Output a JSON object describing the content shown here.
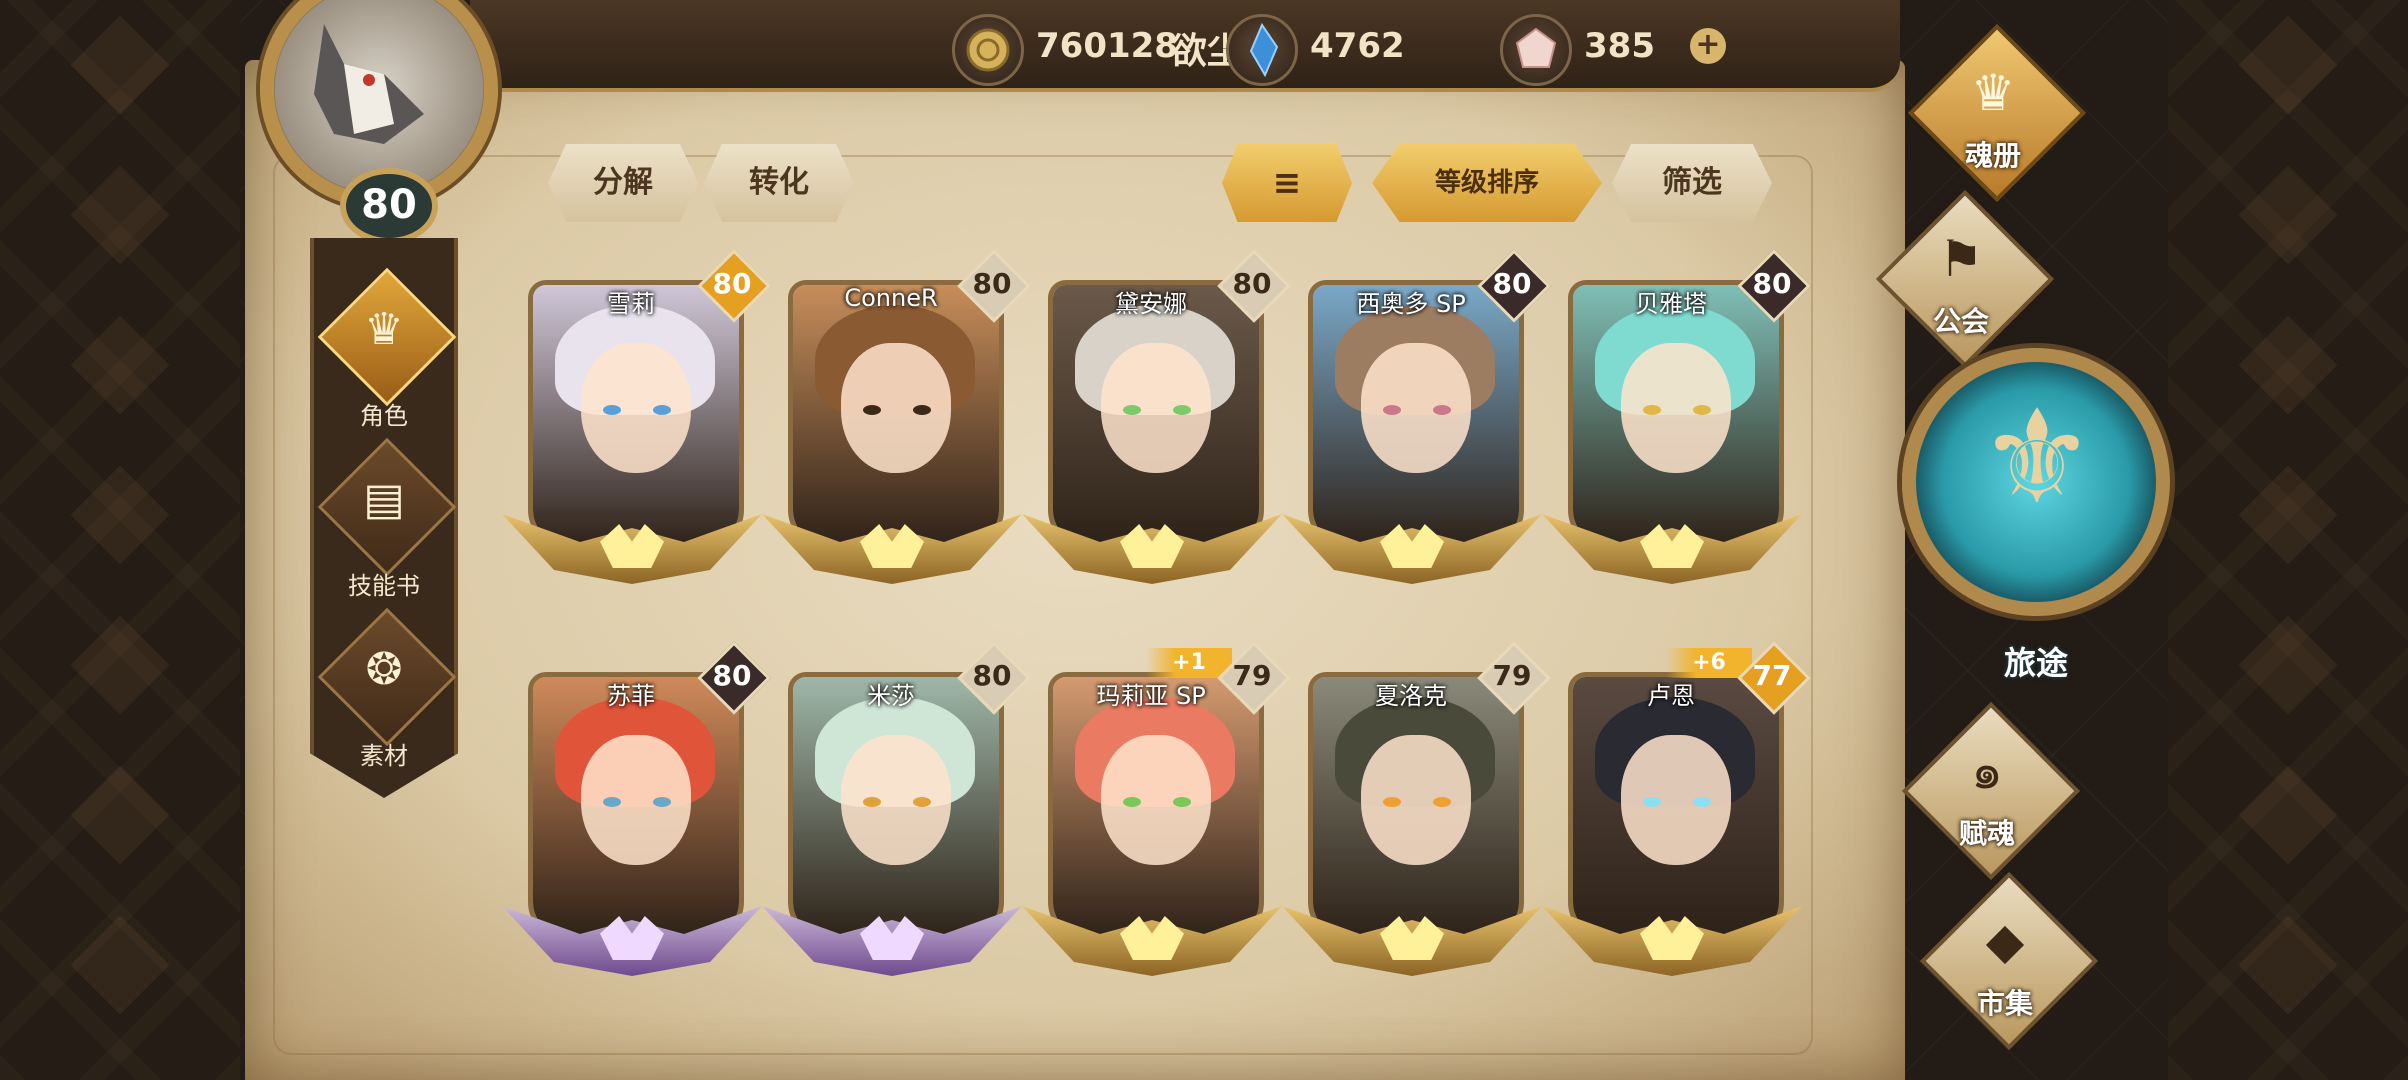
{
  "player": {
    "name": "欲尘",
    "level": "80"
  },
  "currencies": [
    {
      "icon": "gold-coin-icon",
      "value": "760128"
    },
    {
      "icon": "blue-crystal-icon",
      "value": "4762"
    },
    {
      "icon": "pink-gem-icon",
      "value": "385",
      "plus": "+"
    }
  ],
  "toolbar": {
    "decompose": "分解",
    "convert": "转化",
    "sort_icon": "≡",
    "sort_by_level": "等级排序",
    "filter": "筛选"
  },
  "left_nav": [
    {
      "label": "角色",
      "icon": "character-crest-icon",
      "glyph": "♛",
      "active": true
    },
    {
      "label": "技能书",
      "icon": "skill-book-icon",
      "glyph": "▤",
      "active": false
    },
    {
      "label": "素材",
      "icon": "material-icon",
      "glyph": "❂",
      "active": false
    }
  ],
  "right_nav": [
    {
      "label": "魂册",
      "icon": "soul-book-icon",
      "glyph": "♛",
      "active": true
    },
    {
      "label": "公会",
      "icon": "guild-flag-icon",
      "glyph": "⚑",
      "active": false
    },
    {
      "label": "赋魂",
      "icon": "soul-infuse-icon",
      "glyph": "๑",
      "active": false
    },
    {
      "label": "市集",
      "icon": "market-gem-icon",
      "glyph": "◆",
      "active": false
    }
  ],
  "journey": {
    "label": "旅途",
    "icon": "journey-emblem-icon",
    "glyph": "⚜"
  },
  "colors": {
    "gold_badge": "#e6a021",
    "dark_badge": "#3b2a2a",
    "accent": "#d59a30",
    "parchment": "#e2d2b0"
  },
  "characters": [
    {
      "name": "雪莉",
      "level": "80",
      "badge": "gold",
      "plus": "",
      "rarity": "gold",
      "hair": "#e9e3ee",
      "bg": "#cfc7d8",
      "eye": "#5aa0d8"
    },
    {
      "name": "ConneR",
      "level": "80",
      "badge": "light",
      "plus": "",
      "rarity": "gold",
      "hair": "#8a5a32",
      "bg": "#c78d5a",
      "eye": "#3b2a1a"
    },
    {
      "name": "黛安娜",
      "level": "80",
      "badge": "light",
      "plus": "",
      "rarity": "gold",
      "hair": "#d9d2c8",
      "bg": "#6b5a4a",
      "eye": "#7ec96a"
    },
    {
      "name": "西奥多 SP",
      "level": "80",
      "badge": "dark",
      "plus": "",
      "rarity": "gold",
      "hair": "#9c7d62",
      "bg": "#7aa8c8",
      "eye": "#c87a8a"
    },
    {
      "name": "贝雅塔",
      "level": "80",
      "badge": "dark",
      "plus": "",
      "rarity": "gold",
      "hair": "#7fdad0",
      "bg": "#7fbfb6",
      "eye": "#e0b84a"
    },
    {
      "name": "苏菲",
      "level": "80",
      "badge": "dark",
      "plus": "",
      "rarity": "purple",
      "hair": "#e0553a",
      "bg": "#d08a5a",
      "eye": "#6aa8c8"
    },
    {
      "name": "米莎",
      "level": "80",
      "badge": "light",
      "plus": "",
      "rarity": "purple",
      "hair": "#cfe5d6",
      "bg": "#9fb7a8",
      "eye": "#e0a23a"
    },
    {
      "name": "玛莉亚 SP",
      "level": "79",
      "badge": "light",
      "plus": "+1",
      "rarity": "gold",
      "hair": "#ea7a62",
      "bg": "#d49a70",
      "eye": "#7ac85a"
    },
    {
      "name": "夏洛克",
      "level": "79",
      "badge": "light",
      "plus": "",
      "rarity": "gold",
      "hair": "#4a4a3a",
      "bg": "#8a8a7a",
      "eye": "#f0a030"
    },
    {
      "name": "卢恩",
      "level": "77",
      "badge": "gold",
      "plus": "+6",
      "rarity": "gold",
      "hair": "#2a2a32",
      "bg": "#5a4a42",
      "eye": "#8ae0f0"
    }
  ]
}
